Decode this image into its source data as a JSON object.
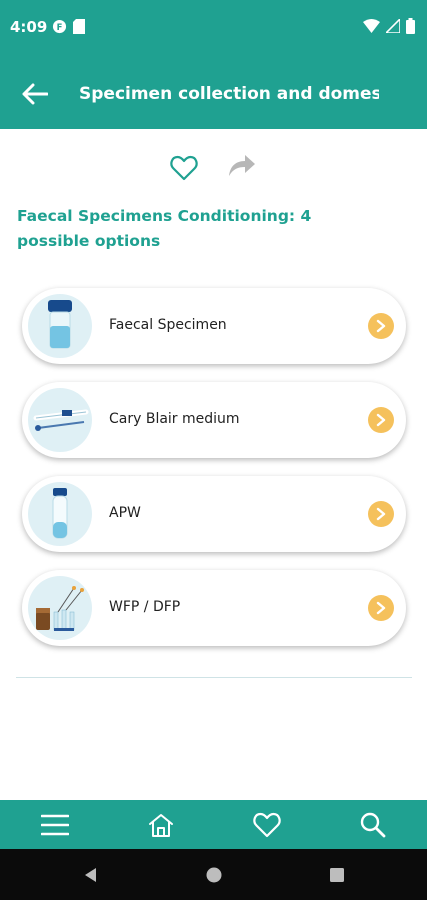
{
  "status_bar": {
    "time": "4:09"
  },
  "app_bar": {
    "title": "Specimen collection and domestic t.."
  },
  "section": {
    "title": "Faecal Specimens Conditioning: 4 possible options"
  },
  "options": [
    {
      "label": "Faecal Specimen",
      "icon": "specimen-jar-icon"
    },
    {
      "label": "Cary Blair medium",
      "icon": "swab-tube-icon"
    },
    {
      "label": "APW",
      "icon": "tube-icon"
    },
    {
      "label": "WFP / DFP",
      "icon": "filter-paper-kit-icon"
    }
  ],
  "bottom_nav": [
    "menu-icon",
    "home-icon",
    "favorites-icon",
    "search-icon"
  ],
  "colors": {
    "primary": "#1fa191",
    "accent": "#f5c15c",
    "thumb_bg": "#dff0f5"
  }
}
